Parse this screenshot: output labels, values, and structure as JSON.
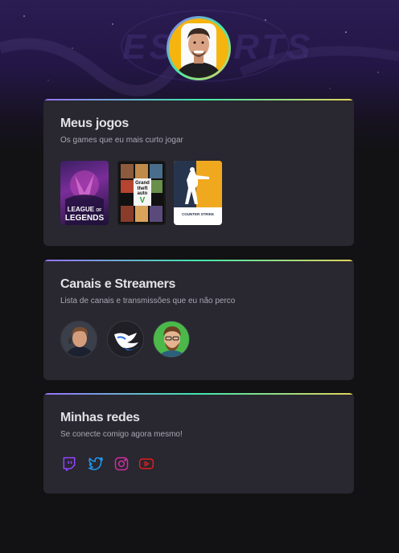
{
  "profile": {
    "avatar": "profile-photo",
    "background_logo": "ESPORTS"
  },
  "games_section": {
    "title": "Meus jogos",
    "subtitle": "Os games que eu mais curto jogar",
    "games": [
      {
        "name": "League of Legends",
        "cover_text_1": "LEAGUE",
        "cover_text_2": "LEGENDS",
        "cover_text_of": "OF"
      },
      {
        "name": "Grand Theft Auto V",
        "cover_text_1": "Grand",
        "cover_text_2": "theft",
        "cover_text_3": "auto",
        "cover_text_4": "V"
      },
      {
        "name": "Counter-Strike",
        "cover_text_1": "COUNTER",
        "cover_text_2": "STRIKE"
      }
    ]
  },
  "channels_section": {
    "title": "Canais e Streamers",
    "subtitle": "Lista de canais e transmissões que eu não perco",
    "channels": [
      {
        "name": "streamer-1"
      },
      {
        "name": "streamer-2"
      },
      {
        "name": "streamer-3"
      }
    ]
  },
  "social_section": {
    "title": "Minhas redes",
    "subtitle": "Se conecte comigo agora mesmo!",
    "links": [
      {
        "icon": "twitch-icon",
        "color": "#9146ff"
      },
      {
        "icon": "twitter-icon",
        "color": "#1d9bf0"
      },
      {
        "icon": "instagram-icon",
        "color": "#d02ea0"
      },
      {
        "icon": "youtube-icon",
        "color": "#e01e1e"
      }
    ]
  },
  "colors": {
    "background": "#121214",
    "card": "#29272f",
    "title": "#e1e1e6",
    "subtitle": "#a8a8b3",
    "gradient": [
      "#9572fc",
      "#43e7ad",
      "#e2d45c"
    ]
  }
}
